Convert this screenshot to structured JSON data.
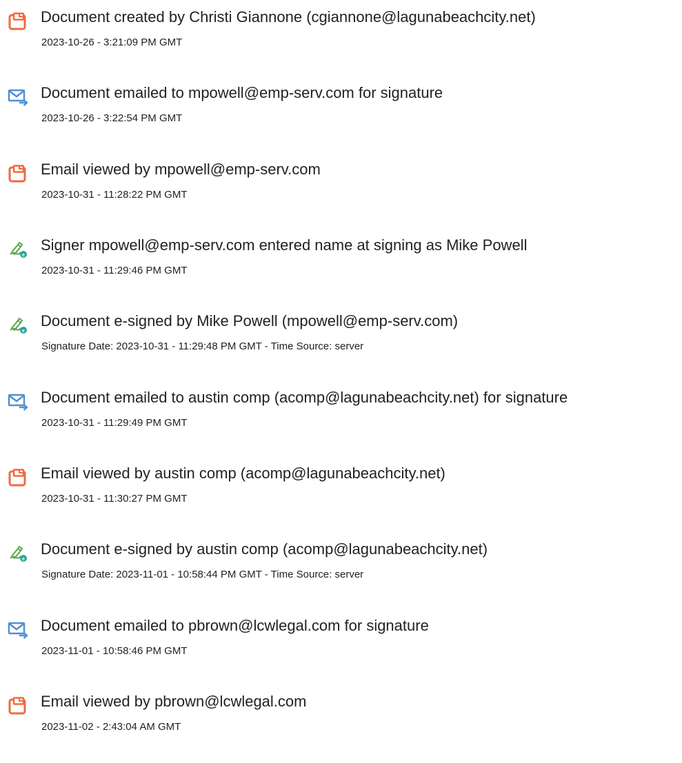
{
  "entries": [
    {
      "icon": "document-icon",
      "event": "Document created by Christi Giannone (cgiannone@lagunabeachcity.net)",
      "timestamp": "2023-10-26 - 3:21:09 PM GMT"
    },
    {
      "icon": "email-sent-icon",
      "event": "Document emailed to mpowell@emp-serv.com for signature",
      "timestamp": "2023-10-26 - 3:22:54 PM GMT"
    },
    {
      "icon": "document-icon",
      "event": "Email viewed by mpowell@emp-serv.com",
      "timestamp": "2023-10-31 - 11:28:22 PM GMT"
    },
    {
      "icon": "esign-pen-icon",
      "event": "Signer mpowell@emp-serv.com entered name at signing as Mike Powell",
      "timestamp": "2023-10-31 - 11:29:46 PM GMT"
    },
    {
      "icon": "esign-pen-icon",
      "event": "Document e-signed by Mike Powell (mpowell@emp-serv.com)",
      "timestamp": "Signature Date: 2023-10-31 - 11:29:48 PM GMT - Time Source: server"
    },
    {
      "icon": "email-sent-icon",
      "event": "Document emailed to austin comp (acomp@lagunabeachcity.net) for signature",
      "timestamp": "2023-10-31 - 11:29:49 PM GMT"
    },
    {
      "icon": "document-icon",
      "event": "Email viewed by austin comp (acomp@lagunabeachcity.net)",
      "timestamp": "2023-10-31 - 11:30:27 PM GMT"
    },
    {
      "icon": "esign-pen-icon",
      "event": "Document e-signed by austin comp (acomp@lagunabeachcity.net)",
      "timestamp": "Signature Date: 2023-11-01 - 10:58:44 PM GMT - Time Source: server"
    },
    {
      "icon": "email-sent-icon",
      "event": "Document emailed to pbrown@lcwlegal.com for signature",
      "timestamp": "2023-11-01 - 10:58:46 PM GMT"
    },
    {
      "icon": "document-icon",
      "event": "Email viewed by pbrown@lcwlegal.com",
      "timestamp": "2023-11-02 - 2:43:04 AM GMT"
    }
  ],
  "colors": {
    "document_icon": "#ef6b3b",
    "email_icon": "#4f8fd6",
    "esign_pen": "#5aa84a",
    "esign_badge": "#27a6a0",
    "text": "#222222"
  }
}
